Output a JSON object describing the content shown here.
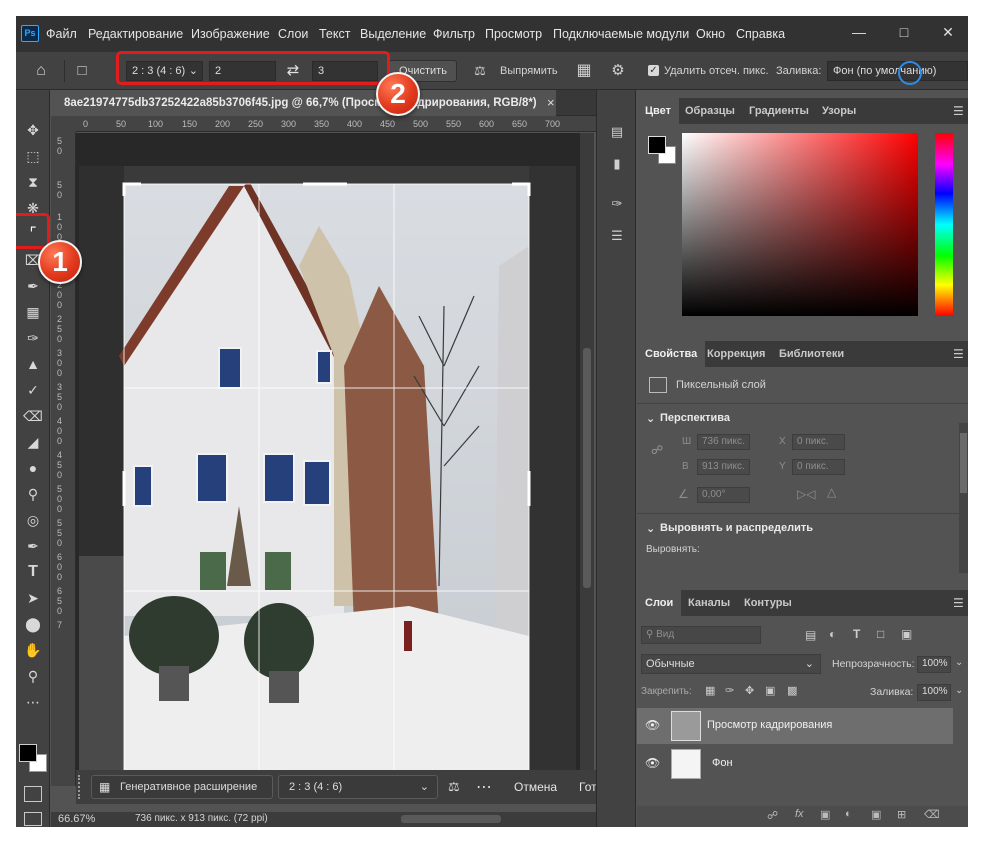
{
  "app": {
    "logo": "Ps",
    "menu": [
      "Файл",
      "Редактирование",
      "Изображение",
      "Слои",
      "Текст",
      "Выделение",
      "Фильтр",
      "Просмотр",
      "Подключаемые модули",
      "Окно",
      "Справка"
    ]
  },
  "options_bar": {
    "ratio_select": "2 : 3 (4 : 6)",
    "width_value": "2",
    "height_value": "3",
    "clear_button": "Очистить",
    "straighten_label": "Выпрямить",
    "delete_cropped_label": "Удалить отсеч. пикс.",
    "delete_cropped_checked": true,
    "fill_label": "Заливка:",
    "fill_value": "Фон (по умолчанию)"
  },
  "document": {
    "tab_title": "8ae21974775db37252422a85b3706f45.jpg @ 66,7% (Просмотр кадрирования, RGB/8*)",
    "ruler_h": [
      "0",
      "50",
      "100",
      "150",
      "200",
      "250",
      "300",
      "350",
      "400",
      "450",
      "500",
      "550",
      "600",
      "650",
      "700"
    ],
    "ruler_v": [
      "5",
      "0",
      "5",
      "0",
      "1",
      "0",
      "0",
      "1",
      "5",
      "0",
      "2",
      "0",
      "0",
      "2",
      "5",
      "0",
      "3",
      "0",
      "0",
      "3",
      "5",
      "0",
      "4",
      "0",
      "0",
      "4",
      "5",
      "0",
      "5",
      "0",
      "0",
      "5",
      "5",
      "0",
      "6",
      "0",
      "0",
      "6",
      "5",
      "0",
      "7"
    ],
    "zoom": "66.67%",
    "dimensions": "736 пикс. x 913 пикс. (72 ppi)"
  },
  "context_bar": {
    "generative_expand": "Генеративное расширение",
    "ratio_select": "2 : 3 (4 : 6)",
    "cancel": "Отмена",
    "done": "Готово"
  },
  "color_panel": {
    "tabs": [
      "Цвет",
      "Образцы",
      "Градиенты",
      "Узоры"
    ],
    "foreground": "#000000",
    "background": "#ffffff",
    "hue": "#ff0000"
  },
  "properties_panel": {
    "tabs": [
      "Свойства",
      "Коррекция",
      "Библиотеки"
    ],
    "layer_type": "Пиксельный слой",
    "perspective_section": "Перспектива",
    "w_label": "Ш",
    "w_value": "736 пикс.",
    "h_label": "В",
    "h_value": "913 пикс.",
    "x_label": "X",
    "x_value": "0 пикс.",
    "y_label": "Y",
    "y_value": "0 пикс.",
    "angle_value": "0,00°",
    "align_section": "Выровнять и распределить",
    "align_label": "Выровнять:"
  },
  "layers_panel": {
    "tabs": [
      "Слои",
      "Каналы",
      "Контуры"
    ],
    "search_placeholder": "Вид",
    "blend_mode": "Обычные",
    "opacity_label": "Непрозрачность:",
    "opacity_value": "100%",
    "lock_label": "Закрепить:",
    "fill_label": "Заливка:",
    "fill_value": "100%",
    "layers": [
      {
        "name": "Просмотр кадрирования",
        "selected": true
      },
      {
        "name": "Фон",
        "selected": false
      }
    ]
  },
  "callouts": [
    "1",
    "2"
  ]
}
